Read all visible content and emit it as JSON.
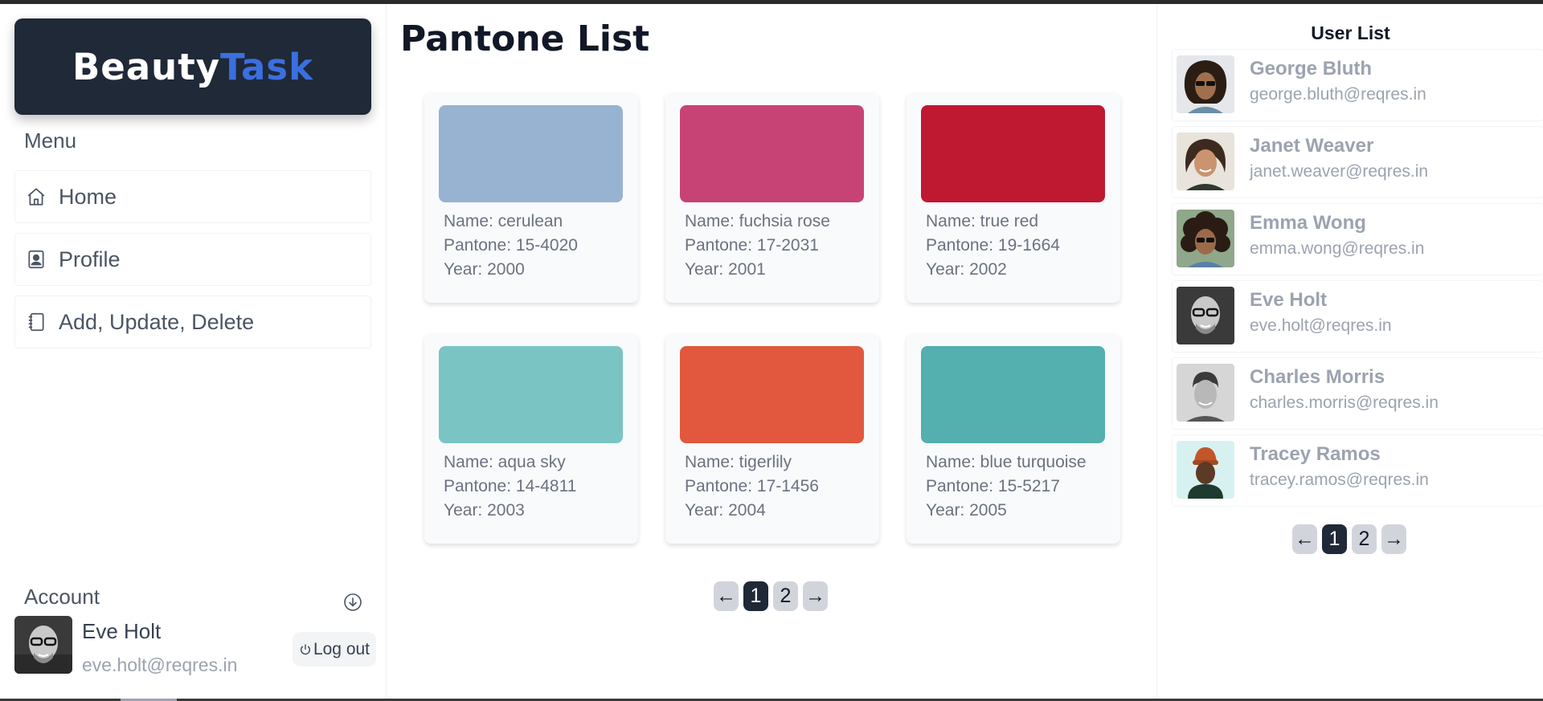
{
  "brand": {
    "part1": "Beauty",
    "part2": "Task"
  },
  "sidebar": {
    "menu_title": "Menu",
    "items": [
      {
        "label": "Home",
        "icon": "home-icon"
      },
      {
        "label": "Profile",
        "icon": "profile-badge-icon"
      },
      {
        "label": "Add, Update, Delete",
        "icon": "notebook-icon"
      }
    ],
    "account": {
      "title": "Account",
      "toggle_icon": "arrow-down-circle-icon",
      "name": "Eve Holt",
      "email": "eve.holt@reqres.in",
      "logout_label": "Log out",
      "logout_icon": "power-icon"
    }
  },
  "main": {
    "title": "Pantone List",
    "cards": [
      {
        "name": "Name: cerulean",
        "pantone": "Pantone: 15-4020",
        "year": "Year: 2000",
        "color": "#98B2D1"
      },
      {
        "name": "Name: fuchsia rose",
        "pantone": "Pantone: 17-2031",
        "year": "Year: 2001",
        "color": "#C74375"
      },
      {
        "name": "Name: true red",
        "pantone": "Pantone: 19-1664",
        "year": "Year: 2002",
        "color": "#BF1932"
      },
      {
        "name": "Name: aqua sky",
        "pantone": "Pantone: 14-4811",
        "year": "Year: 2003",
        "color": "#7BC4C4"
      },
      {
        "name": "Name: tigerlily",
        "pantone": "Pantone: 17-1456",
        "year": "Year: 2004",
        "color": "#E2583E"
      },
      {
        "name": "Name: blue turquoise",
        "pantone": "Pantone: 15-5217",
        "year": "Year: 2005",
        "color": "#53B0AE"
      }
    ],
    "pagination": {
      "prev": "←",
      "pages": [
        "1",
        "2"
      ],
      "active": "1",
      "next": "→"
    }
  },
  "users_panel": {
    "title": "User List",
    "users": [
      {
        "name": "George Bluth",
        "email": "george.bluth@reqres.in"
      },
      {
        "name": "Janet Weaver",
        "email": "janet.weaver@reqres.in"
      },
      {
        "name": "Emma Wong",
        "email": "emma.wong@reqres.in"
      },
      {
        "name": "Eve Holt",
        "email": "eve.holt@reqres.in"
      },
      {
        "name": "Charles Morris",
        "email": "charles.morris@reqres.in"
      },
      {
        "name": "Tracey Ramos",
        "email": "tracey.ramos@reqres.in"
      }
    ],
    "pagination": {
      "prev": "←",
      "pages": [
        "1",
        "2"
      ],
      "active": "1",
      "next": "→"
    }
  }
}
